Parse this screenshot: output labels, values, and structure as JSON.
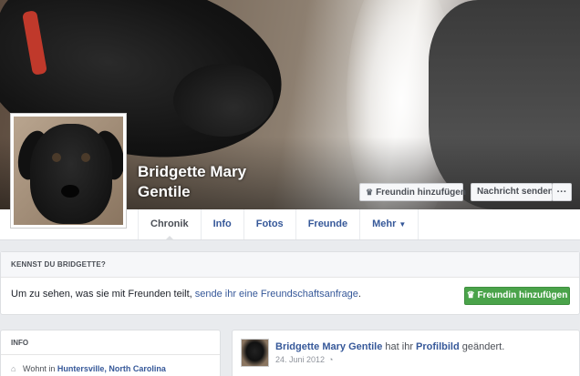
{
  "profile": {
    "name_line1": "Bridgette Mary",
    "name_line2": "Gentile"
  },
  "cover_actions": {
    "add_friend": "Freundin hinzufügen",
    "send_message": "Nachricht senden",
    "more": "···"
  },
  "tabs": [
    {
      "label": "Chronik"
    },
    {
      "label": "Info"
    },
    {
      "label": "Fotos"
    },
    {
      "label": "Freunde"
    },
    {
      "label": "Mehr"
    }
  ],
  "know": {
    "header": "KENNST DU BRIDGETTE?",
    "text": "Um zu sehen, was sie mit Freunden teilt, ",
    "link": "sende ihr eine Freundschaftsanfrage",
    "text_end": ".",
    "button": "Freundin hinzufügen"
  },
  "info": {
    "header": "INFO",
    "lives_prefix": "Wohnt in ",
    "lives_location": "Huntersville, North Carolina"
  },
  "post": {
    "author": "Bridgette Mary Gentile",
    "action": " hat ihr ",
    "object": "Profilbild",
    "action_end": " geändert.",
    "date": "24. Juni 2012"
  },
  "colors": {
    "link": "#365899",
    "green_button": "#4aa34a",
    "background": "#e9ebee"
  }
}
